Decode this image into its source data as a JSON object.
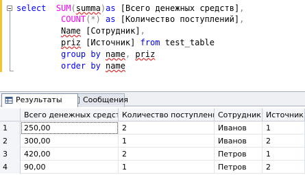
{
  "editor": {
    "lines": [
      {
        "tokens": [
          {
            "t": "select",
            "c": "kw"
          },
          {
            "t": "  ",
            "c": ""
          },
          {
            "t": "SUM",
            "c": "fn"
          },
          {
            "t": "(",
            "c": "op"
          },
          {
            "t": "summa",
            "c": "sq"
          },
          {
            "t": ")",
            "c": "op"
          },
          {
            "t": "as",
            "c": "kw"
          },
          {
            "t": " [Всего денежных средств]",
            "c": ""
          },
          {
            "t": ",",
            "c": "op"
          }
        ]
      },
      {
        "tokens": [
          {
            "t": "COUNT",
            "c": "fn"
          },
          {
            "t": "(*)",
            "c": "op"
          },
          {
            "t": " ",
            "c": ""
          },
          {
            "t": "as",
            "c": "kw"
          },
          {
            "t": " [Количество поступлений]",
            "c": ""
          },
          {
            "t": ",",
            "c": "op"
          }
        ]
      },
      {
        "tokens": [
          {
            "t": "Name",
            "c": "sq"
          },
          {
            "t": " [Сотрудник]",
            "c": ""
          },
          {
            "t": ",",
            "c": "op"
          }
        ]
      },
      {
        "tokens": [
          {
            "t": "priz",
            "c": "sq"
          },
          {
            "t": " [Источник] ",
            "c": ""
          },
          {
            "t": "from",
            "c": "kw"
          },
          {
            "t": " test_table",
            "c": ""
          }
        ]
      },
      {
        "tokens": [
          {
            "t": "group by",
            "c": "kw"
          },
          {
            "t": " ",
            "c": ""
          },
          {
            "t": "name",
            "c": "sq"
          },
          {
            "t": ",",
            "c": "op"
          },
          {
            "t": " ",
            "c": ""
          },
          {
            "t": "priz",
            "c": "sq"
          }
        ]
      },
      {
        "tokens": [
          {
            "t": "order by",
            "c": "kw"
          },
          {
            "t": " ",
            "c": ""
          },
          {
            "t": "name",
            "c": "sq"
          }
        ]
      }
    ]
  },
  "tabs": [
    {
      "label": "Результаты",
      "icon": "grid-icon",
      "active": true
    },
    {
      "label": "Сообщения",
      "icon": "message-icon",
      "active": false
    }
  ],
  "grid": {
    "columns": [
      "Всего денежных средств",
      "Количество поступлений",
      "Сотрудник",
      "Источник"
    ],
    "rows": [
      {
        "num": "1",
        "cells": [
          "250,00",
          "2",
          "Иванов",
          "1"
        ]
      },
      {
        "num": "2",
        "cells": [
          "300,00",
          "1",
          "Иванов",
          "2"
        ]
      },
      {
        "num": "3",
        "cells": [
          "420,00",
          "2",
          "Петров",
          "1"
        ]
      },
      {
        "num": "4",
        "cells": [
          "90,00",
          "1",
          "Петров",
          "2"
        ]
      }
    ]
  },
  "colors": {
    "keyword": "#0000ff",
    "function": "#ff00ff",
    "operator": "#808080",
    "marker": "#f2c52a"
  }
}
